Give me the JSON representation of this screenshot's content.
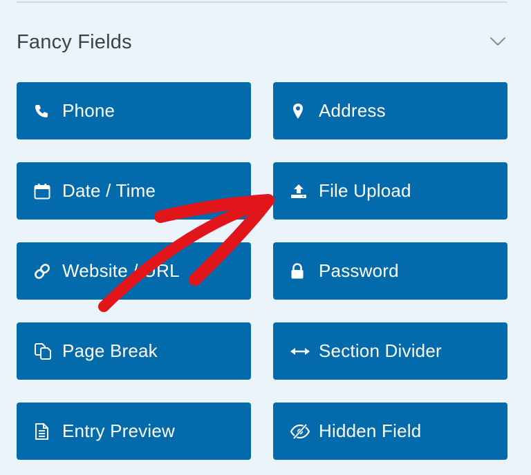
{
  "section": {
    "title": "Fancy Fields",
    "collapse_icon": "chevron-down-icon"
  },
  "fields": [
    {
      "label": "Phone",
      "icon": "phone-icon"
    },
    {
      "label": "Address",
      "icon": "map-marker-icon"
    },
    {
      "label": "Date / Time",
      "icon": "calendar-icon"
    },
    {
      "label": "File Upload",
      "icon": "upload-icon"
    },
    {
      "label": "Website / URL",
      "icon": "link-icon"
    },
    {
      "label": "Password",
      "icon": "lock-icon"
    },
    {
      "label": "Page Break",
      "icon": "copy-icon"
    },
    {
      "label": "Section Divider",
      "icon": "arrows-horizontal-icon"
    },
    {
      "label": "Entry Preview",
      "icon": "document-icon"
    },
    {
      "label": "Hidden Field",
      "icon": "eye-slash-icon"
    }
  ],
  "colors": {
    "background": "#ebf3fb",
    "button": "#036aab",
    "button_text": "#ffffff",
    "title_text": "#3c434a",
    "annotation_arrow": "#e2151b"
  }
}
